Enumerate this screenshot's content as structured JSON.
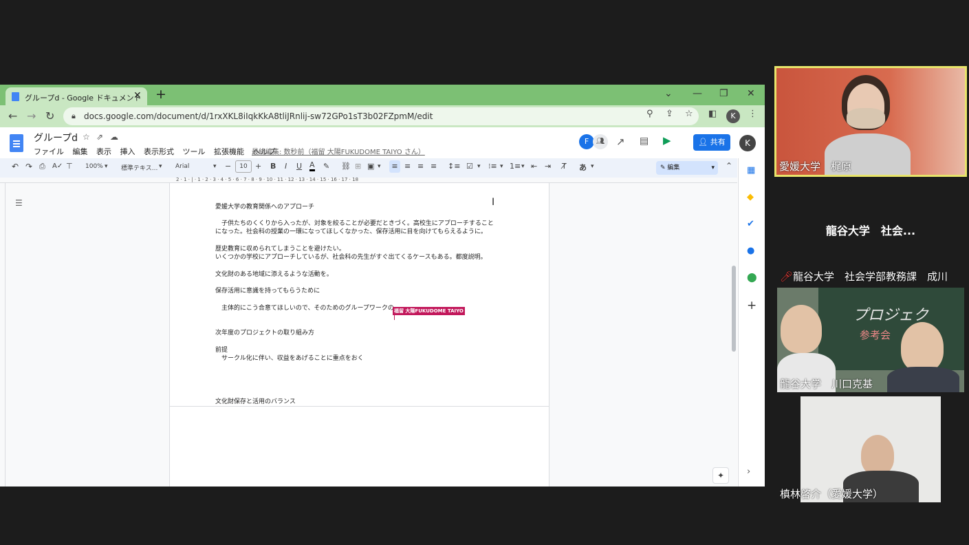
{
  "browser": {
    "tab_title": "グループd - Google ドキュメント",
    "url": "docs.google.com/document/d/1rxXKL8iIqkKkA8tliJRnlij-sw72GPo1sT3b02FZpmM/edit",
    "profile_initial": "K"
  },
  "docs": {
    "title": "グループd",
    "menu": [
      "ファイル",
      "編集",
      "表示",
      "挿入",
      "表示形式",
      "ツール",
      "拡張機能",
      "ヘルプ"
    ],
    "last_edit": "最終編集: 数秒前（福留 大陽FUKUDOME TAIYO さん）",
    "collaborator_initial": "F",
    "share_label": "共有",
    "account_initial": "K"
  },
  "toolbar": {
    "zoom": "100%",
    "style": "標準テキス...",
    "font": "Arial",
    "font_size": "10",
    "input_mode": "あ",
    "editing_mode": "編集"
  },
  "ruler": {
    "labels": "2 · 1 · | · 1 · 2 · 3 · 4 · 5 · 6 · 7 · 8 · 9 · 10 · 11 · 12 · 13 · 14 · 15 · 16 · 17 · 18"
  },
  "document": {
    "lines": [
      "愛媛大学の教育関係へのアプローチ",
      "　子供たちのくくりから入ったが、対象を絞ることが必要だときづく。高校生にアプローチすること",
      "になった。社会科の授業の一環になってほしくなかった、保存活用に目を向けてもらえるように。",
      "歴史教育に収められてしまうことを避けたい。",
      "いくつかの学校にアプローチしているが、社会科の先生がすぐ出てくるケースもある。都度説明。",
      "文化財のある地域に添えるような活動を。",
      "保存活用に意識を持ってもらうために",
      "　主体的にこう合意てほしいので、そのためのグループワークの",
      "次年度のプロジェクトの取り組み方",
      "前提",
      "　サークル化に伴い、収益をあげることに重点をおく",
      "文化財保存と活用のバランス"
    ],
    "cursor_label": "福留 大陽FUKUDOME TAIYO"
  },
  "video": {
    "tile1_name": "愛媛大学　梶原",
    "tile2_center": "龍谷大学　社会...",
    "tile2_name": "龍谷大学　社会学部教務課　成川",
    "tile3_name": "龍谷大学　川口克基",
    "tile3_board": "プロジェク",
    "tile3_board2": "参考会",
    "tile4_name": "槙林啓介（愛媛大学）"
  },
  "colors": {
    "tab_strip": "#7cc074",
    "address_bar": "#c9e7c2",
    "share": "#1a73e8",
    "cursor": "#c2185b",
    "active_speaker": "#e8e56b"
  }
}
